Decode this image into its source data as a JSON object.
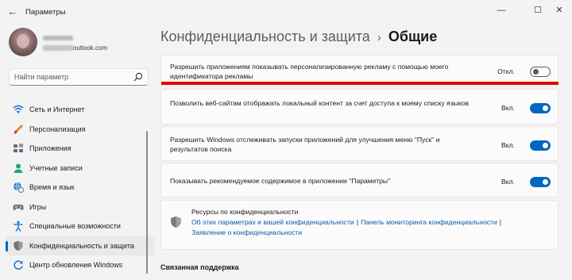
{
  "window": {
    "title": "Параметры",
    "minimize": "—",
    "maximize": "☐",
    "close": "✕"
  },
  "account": {
    "email_domain": "outlook.com"
  },
  "search": {
    "placeholder": "Найти параметр"
  },
  "sidebar": {
    "items": [
      {
        "label": "Сеть и Интернет",
        "icon": "wifi-icon"
      },
      {
        "label": "Персонализация",
        "icon": "brush-icon"
      },
      {
        "label": "Приложения",
        "icon": "apps-icon"
      },
      {
        "label": "Учетные записи",
        "icon": "person-icon"
      },
      {
        "label": "Время и язык",
        "icon": "globe-clock-icon"
      },
      {
        "label": "Игры",
        "icon": "gamepad-icon"
      },
      {
        "label": "Специальные возможности",
        "icon": "accessibility-icon"
      },
      {
        "label": "Конфиденциальность и защита",
        "icon": "shield-icon",
        "selected": true
      },
      {
        "label": "Центр обновления Windows",
        "icon": "update-icon"
      }
    ]
  },
  "breadcrumb": {
    "parent": "Конфиденциальность и защита",
    "separator": "›",
    "current": "Общие"
  },
  "settings": [
    {
      "text": "Разрешить приложениям показывать персонализированную рекламу с помощью моего идентификатора рекламы",
      "state_label": "Откл.",
      "on": false
    },
    {
      "text": "Позволить веб-сайтам отображать локальный контент за счет доступа к моему списку языков",
      "state_label": "Вкл.",
      "on": true
    },
    {
      "text": "Разрешить Windows отслеживать запуски приложений для улучшения меню \"Пуск\" и результатов поиска",
      "state_label": "Вкл.",
      "on": true
    },
    {
      "text": "Показывать рекомендуемое содержимое в приложении \"Параметры\"",
      "state_label": "Вкл.",
      "on": true
    }
  ],
  "resources": {
    "title": "Ресурсы по конфиденциальности",
    "link1": "Об этих параметрах и вашей конфиденциальности",
    "link2": "Панель мониторинга конфиденциальности",
    "link3": "Заявление о конфиденциальности",
    "separator": "|"
  },
  "related": {
    "title": "Связанная поддержка"
  },
  "colors": {
    "accent": "#0067c0",
    "highlight_line": "#e00000",
    "link": "#0b5cad"
  }
}
